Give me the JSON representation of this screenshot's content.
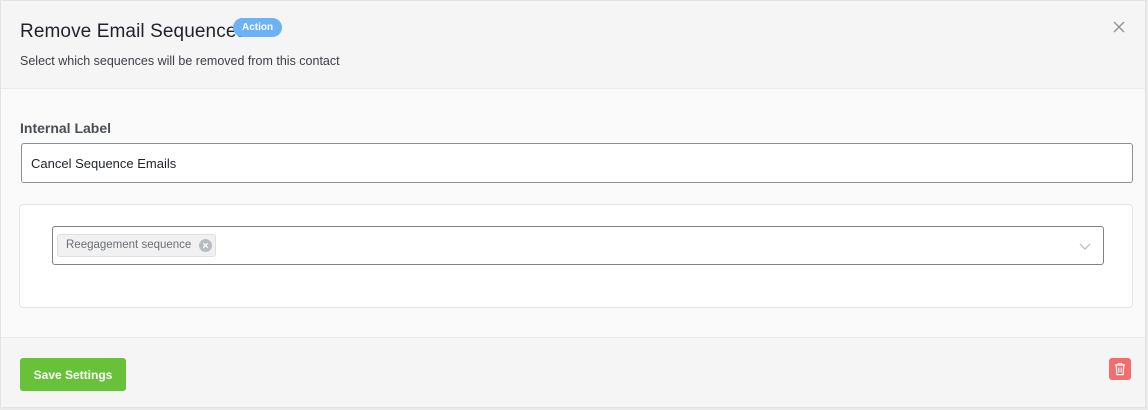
{
  "header": {
    "title": "Remove Email Sequences",
    "badge": "Action",
    "subtitle": "Select which sequences will be removed from this contact"
  },
  "form": {
    "internal_label": {
      "label": "Internal Label",
      "value": "Cancel Sequence Emails"
    },
    "sequences": {
      "selected": [
        "Reegagement sequence"
      ]
    }
  },
  "footer": {
    "save_label": "Save Settings"
  },
  "icons": {
    "close": "close-icon",
    "tag_remove": "tag-remove-icon",
    "dropdown": "chevron-down-icon",
    "delete": "trash-icon"
  },
  "colors": {
    "badge": "#6cb3f5",
    "primary_button": "#67c23a",
    "danger_button": "#f26e6e"
  }
}
